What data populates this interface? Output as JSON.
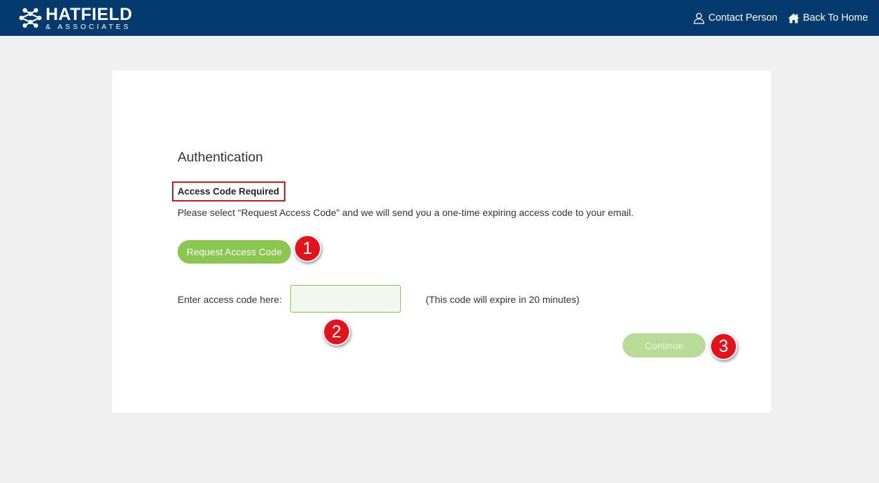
{
  "header": {
    "logo_name": "HATFIELD",
    "logo_sub": "& ASSOCIATES",
    "contact_label": "Contact Person",
    "home_label": "Back To Home",
    "background_color": "#043a6e"
  },
  "auth": {
    "title": "Authentication",
    "required_label": "Access Code Required",
    "instructions": "Please select “Request Access Code” and we will send you a one-time expiring access code to your email.",
    "request_button_label": "Request Access Code",
    "code_field_label": "Enter access code here:",
    "code_field_value": "",
    "expire_note": "(This code will expire in 20 minutes)",
    "continue_button_label": "Continue",
    "accent_color": "#8bc651"
  },
  "callouts": {
    "step1": "1",
    "step2": "2",
    "step3": "3",
    "color": "#e3121b"
  },
  "icons": {
    "logo": "hatfield-logo-icon",
    "contact": "user-icon",
    "home": "home-icon"
  }
}
